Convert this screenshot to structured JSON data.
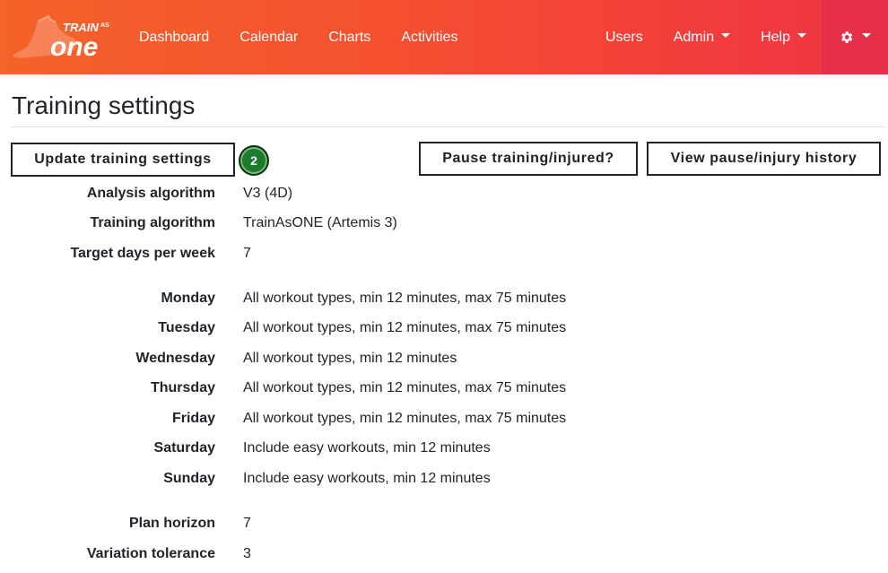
{
  "brand": {
    "line1": "TRAIN",
    "line2": "AS",
    "line3": "one"
  },
  "nav": {
    "dashboard": "Dashboard",
    "calendar": "Calendar",
    "charts": "Charts",
    "activities": "Activities",
    "users": "Users",
    "admin": "Admin",
    "help": "Help"
  },
  "page": {
    "title": "Training settings"
  },
  "buttons": {
    "update": "Update training settings",
    "pause": "Pause training/injured?",
    "history": "View pause/injury history"
  },
  "badge": {
    "count": "2"
  },
  "settings": {
    "analysis_label": "Analysis algorithm",
    "analysis_value": "V3 (4D)",
    "training_label": "Training algorithm",
    "training_value": "TrainAsONE (Artemis 3)",
    "target_label": "Target days per week",
    "target_value": "7",
    "days": [
      {
        "label": "Monday",
        "value": "All workout types, min 12 minutes, max 75 minutes"
      },
      {
        "label": "Tuesday",
        "value": "All workout types, min 12 minutes, max 75 minutes"
      },
      {
        "label": "Wednesday",
        "value": "All workout types, min 12 minutes"
      },
      {
        "label": "Thursday",
        "value": "All workout types, min 12 minutes, max 75 minutes"
      },
      {
        "label": "Friday",
        "value": "All workout types, min 12 minutes, max 75 minutes"
      },
      {
        "label": "Saturday",
        "value": "Include easy workouts, min 12 minutes"
      },
      {
        "label": "Sunday",
        "value": "Include easy workouts, min 12 minutes"
      }
    ],
    "horizon_label": "Plan horizon",
    "horizon_value": "7",
    "variation_label": "Variation tolerance",
    "variation_value": "3"
  },
  "colors": {
    "navbar_start": "#f4632a",
    "navbar_end": "#ee3446",
    "gear_bg": "#e6304a",
    "badge_bg": "#1e7a2e"
  },
  "icons": {
    "brand": "shoe-logo-icon",
    "settings": "gear-icon",
    "dropdown": "caret-down-icon"
  }
}
